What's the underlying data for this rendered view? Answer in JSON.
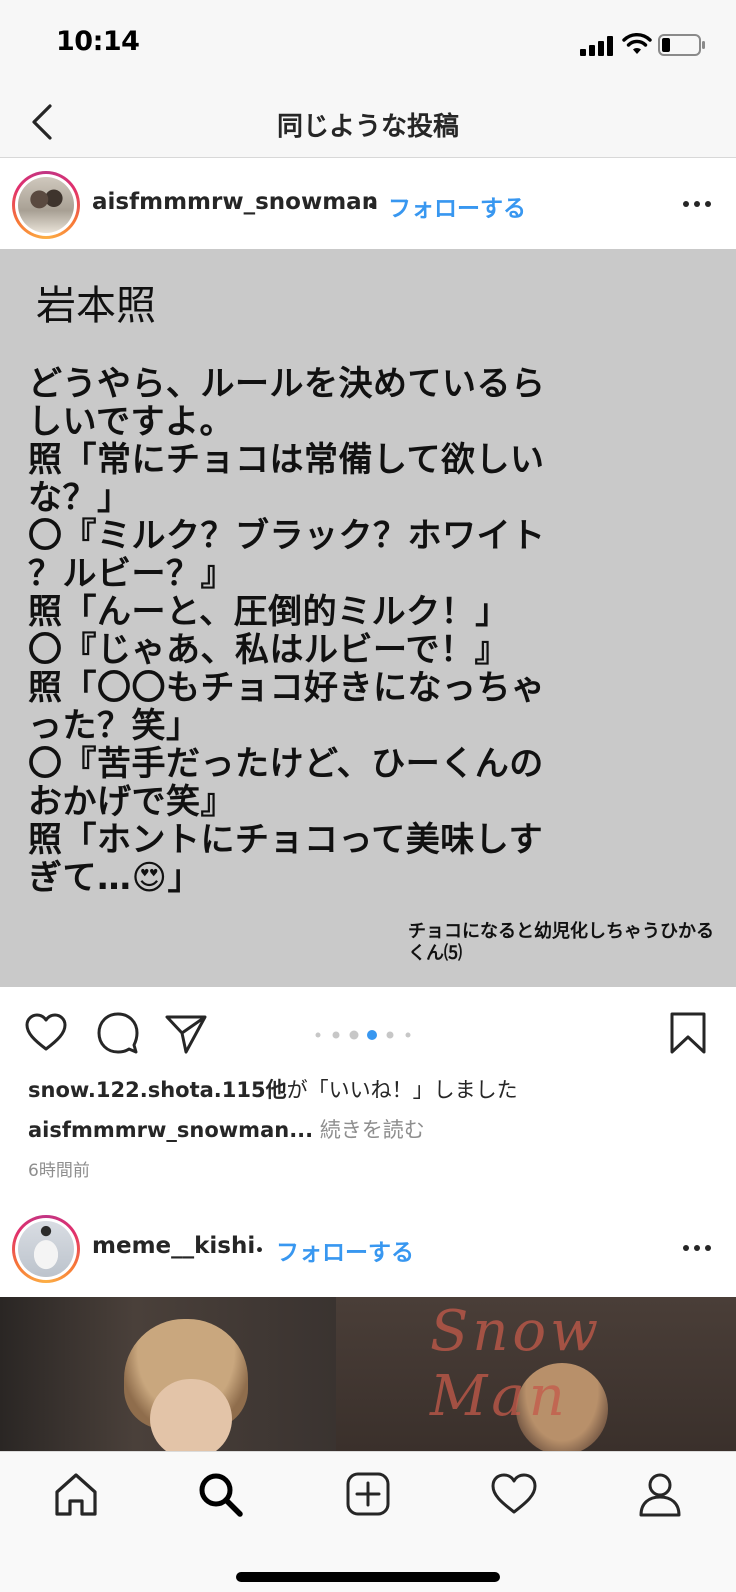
{
  "status_bar": {
    "time": "10:14"
  },
  "nav": {
    "title": "同じような投稿"
  },
  "post1": {
    "username": "aisfmmmrw_snowman",
    "separator": "・",
    "follow": "フォローする",
    "image": {
      "title": "岩本照",
      "body": "どうやら、ルールを決めているら\nしいですよ。\n照「常にチョコは常備して欲しい\nな？」\n〇『ミルク？ブラック？ホワイト\n？ルビー？』\n照「んーと、圧倒的ミルク！」\n〇『じゃあ、私はルビーで！』\n照「〇〇もチョコ好きになっちゃ\nった？笑」\n〇『苦手だったけど、ひーくんの\nおかげで笑』\n照「ホントにチョコって美味しす\nぎて…😍」",
      "footnote": "チョコになると幼児化しちゃうひかるくん⑸"
    },
    "carousel": {
      "count": 6,
      "active_index": 3
    },
    "likes_user": "snow.122.shota.115他",
    "likes_suffix": "が「いいね！」しました",
    "caption_user": "aisfmmmrw_snowman...",
    "caption_more": " 続きを読む",
    "time_ago": "6時間前"
  },
  "post2": {
    "username": "meme__kishi",
    "separator": "・",
    "follow": "フォローする",
    "image_script_text": "Snow Man"
  },
  "icons": {
    "back": "chevron-left-icon",
    "more": "more-horizontal-icon",
    "like": "heart-icon",
    "comment": "comment-icon",
    "share": "paper-plane-icon",
    "save": "bookmark-icon",
    "tabs": [
      "home-icon",
      "search-icon",
      "add-post-icon",
      "activity-heart-icon",
      "profile-icon"
    ]
  },
  "colors": {
    "link": "#3897f0",
    "active_dot": "#3897f0",
    "image_bg": "#c9c9c9"
  }
}
